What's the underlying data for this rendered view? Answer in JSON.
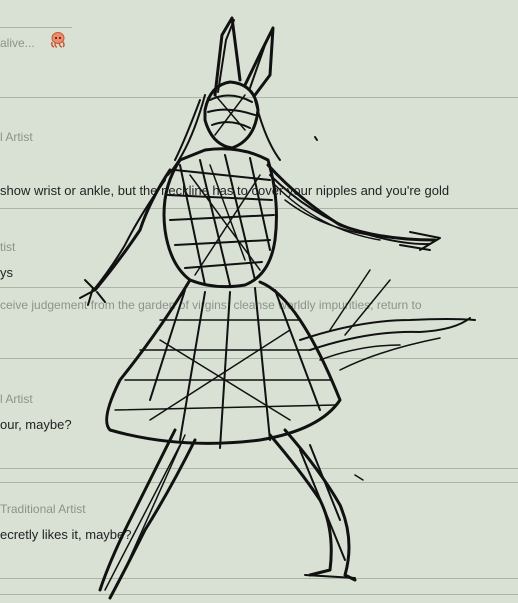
{
  "posts": [
    {
      "top_text": "alive..."
    },
    {
      "author": "l Artist",
      "message": "show wrist or ankle, but the neckline has to cover your nipples and you're gold"
    },
    {
      "author": "tist",
      "message": "ys"
    },
    {
      "quote": "ceive judgement from the garden of virgins; cleanse worldly impurities; return to"
    },
    {
      "author": "l Artist",
      "message": "our, maybe?"
    },
    {
      "author": "Traditional Artist",
      "message": "ecretly likes it, maybe?"
    }
  ]
}
